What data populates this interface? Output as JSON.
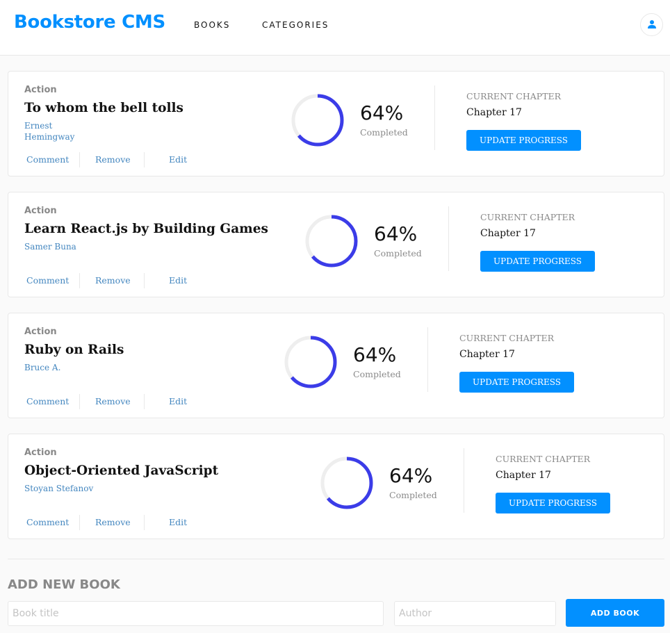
{
  "header": {
    "logo": "Bookstore CMS",
    "nav": [
      "BOOKS",
      "CATEGORIES"
    ],
    "user_icon": "user-icon"
  },
  "books": [
    {
      "genre": "Action",
      "title": "To whom the bell tolls",
      "author": "Ernest Hemingway",
      "progress": 64,
      "percent_text": "64%",
      "completed_label": "Completed",
      "chapter_label": "CURRENT CHAPTER",
      "chapter": "Chapter 17",
      "update_label": "UPDATE PROGRESS",
      "actions": [
        "Comment",
        "Remove",
        "Edit"
      ]
    },
    {
      "genre": "Action",
      "title": "Learn React.js by Building Games",
      "author": "Samer Buna",
      "progress": 64,
      "percent_text": "64%",
      "completed_label": "Completed",
      "chapter_label": "CURRENT CHAPTER",
      "chapter": "Chapter 17",
      "update_label": "UPDATE PROGRESS",
      "actions": [
        "Comment",
        "Remove",
        "Edit"
      ]
    },
    {
      "genre": "Action",
      "title": "Ruby on Rails",
      "author": "Bruce A.",
      "progress": 64,
      "percent_text": "64%",
      "completed_label": "Completed",
      "chapter_label": "CURRENT CHAPTER",
      "chapter": "Chapter 17",
      "update_label": "UPDATE PROGRESS",
      "actions": [
        "Comment",
        "Remove",
        "Edit"
      ]
    },
    {
      "genre": "Action",
      "title": "Object-Oriented JavaScript",
      "author": "Stoyan Stefanov",
      "progress": 64,
      "percent_text": "64%",
      "completed_label": "Completed",
      "chapter_label": "CURRENT CHAPTER",
      "chapter": "Chapter 17",
      "update_label": "UPDATE PROGRESS",
      "actions": [
        "Comment",
        "Remove",
        "Edit"
      ]
    }
  ],
  "add_form": {
    "heading": "ADD NEW BOOK",
    "title_placeholder": "Book title",
    "author_placeholder": "Author",
    "button_label": "ADD BOOK"
  },
  "colors": {
    "accent": "#0290ff",
    "progress": "#3b3ce8",
    "link": "#4386bf"
  }
}
